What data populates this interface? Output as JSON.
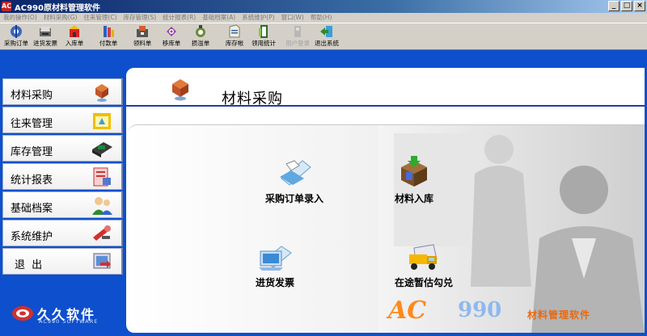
{
  "window": {
    "title": "AC990原材料管理软件",
    "icon_text": "AC"
  },
  "menu": [
    "我的操作(O)",
    "材料采购(G)",
    "往来管理(C)",
    "库存管理(S)",
    "统计报表(R)",
    "基础档案(A)",
    "系统维护(P)",
    "窗口(W)",
    "帮助(H)"
  ],
  "toolbar": [
    {
      "label": "采购订单",
      "icon": "order-icon",
      "color": "#3366cc"
    },
    {
      "label": "进货发票",
      "icon": "invoice-icon",
      "color": "#333333"
    },
    {
      "label": "入库单",
      "icon": "inbound-icon",
      "color": "#cc3333"
    },
    {
      "label": "付款单",
      "icon": "payment-icon",
      "color": "#2d5fbf"
    },
    {
      "label": "领料单",
      "icon": "pick-icon",
      "color": "#555555"
    },
    {
      "label": "移库单",
      "icon": "transfer-icon",
      "color": "#8844aa"
    },
    {
      "label": "损溢单",
      "icon": "loss-icon",
      "color": "#557733"
    },
    {
      "label": "库存帐",
      "icon": "stock-book-icon",
      "color": "#3366aa"
    },
    {
      "label": "领用统计",
      "icon": "usage-stats-icon",
      "color": "#336633"
    },
    {
      "label": "用户登录",
      "icon": "login-icon",
      "color": "#aaaaaa",
      "disabled": true
    },
    {
      "label": "退出系统",
      "icon": "exit-icon",
      "color": "#2277cc"
    }
  ],
  "sidebar": [
    {
      "label": "材料采购",
      "icon": "purchase-icon"
    },
    {
      "label": "往来管理",
      "icon": "accounts-icon"
    },
    {
      "label": "库存管理",
      "icon": "inventory-icon"
    },
    {
      "label": "统计报表",
      "icon": "report-icon"
    },
    {
      "label": "基础档案",
      "icon": "users-icon"
    },
    {
      "label": "系统维护",
      "icon": "tools-icon"
    },
    {
      "label": "退    出",
      "icon": "exit-icon"
    }
  ],
  "brand": {
    "name": "久久软件",
    "sub": "AC990 SOFTWARE"
  },
  "page": {
    "title": "材料采购"
  },
  "actions": [
    {
      "label": "采购订单录入",
      "icon": "order-entry-icon"
    },
    {
      "label": "材料入库",
      "icon": "material-inbound-icon"
    },
    {
      "label": "进货发票",
      "icon": "purchase-invoice-icon"
    },
    {
      "label": "在途暂估勾兑",
      "icon": "in-transit-icon"
    }
  ],
  "watermark": {
    "ac": "AC",
    "num": "990",
    "tag": "材料管理软件"
  },
  "colors": {
    "accent_blue": "#0e4fcd",
    "header_line": "#1f3f9f",
    "brand_orange": "#ff8a1a"
  }
}
